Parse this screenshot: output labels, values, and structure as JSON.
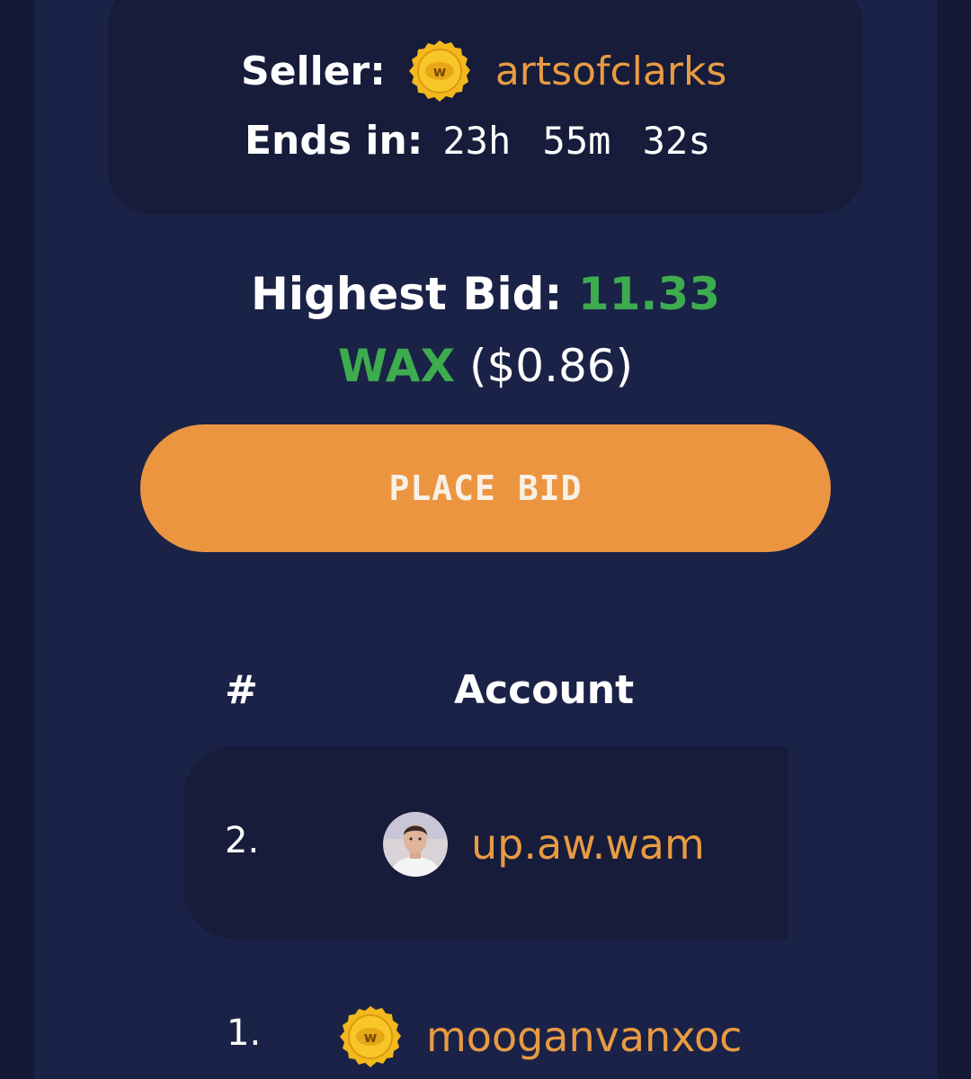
{
  "auction": {
    "seller_label": "Seller:",
    "seller_name": "artsofclarks",
    "ends_label": "Ends in:",
    "countdown": "23h 55m 32s"
  },
  "bid": {
    "label": "Highest Bid:",
    "amount": "11.33",
    "currency": "WAX",
    "usd": "($0.86)"
  },
  "place_bid_label": "PLACE BID",
  "table": {
    "headers": [
      "#",
      "Account"
    ],
    "rows": [
      {
        "rank": "2.",
        "account": "up.aw.wam",
        "avatar": "user-photo-avatar"
      },
      {
        "rank": "1.",
        "account": "mooganvanxoc",
        "avatar": "wax-coin-icon"
      }
    ]
  },
  "colors": {
    "accent": "#ec9540",
    "link": "#e89b43",
    "green": "#3dac4f",
    "panel": "#1b2247",
    "card": "#161c3a"
  },
  "icons": {
    "coin": "wax-coin-icon",
    "coin_letter": "w"
  }
}
